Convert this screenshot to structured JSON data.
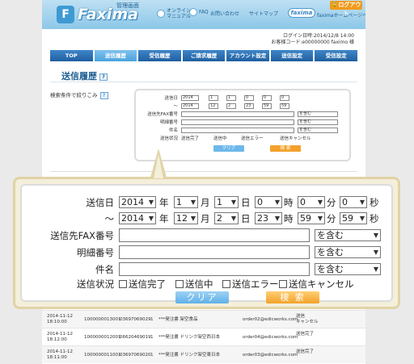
{
  "header": {
    "logo_text": "Faxima",
    "logo_subtitle": "管理画面",
    "nav": [
      {
        "label": "オンライン\nマニュアル"
      },
      {
        "label": "FAQ"
      },
      {
        "label": "お問い合わせ"
      },
      {
        "label": "サイトマップ"
      }
    ],
    "brand_badge": "faxima",
    "home_link": "faximaホームページへ",
    "logout_label": "ログアウト"
  },
  "login_info": {
    "line1": "ログイン日時:2014/12/8 14:00",
    "line2": "お客様コード:e00000000 faximo 様"
  },
  "tabs": [
    {
      "label": "TOP",
      "active": false
    },
    {
      "label": "送信履歴",
      "active": true
    },
    {
      "label": "受信履歴",
      "active": false
    },
    {
      "label": "ご請求履歴",
      "active": false
    },
    {
      "label": "アカウント設定",
      "active": false
    },
    {
      "label": "送信設定",
      "active": false
    },
    {
      "label": "受信設定",
      "active": false
    }
  ],
  "page_title": "送信履歴",
  "filter_label": "検索条件で絞りこみ",
  "search": {
    "date_label": "送信日",
    "range_sep": "〜",
    "from": {
      "year": "2014",
      "month": "1",
      "day": "1",
      "hour": "0",
      "minute": "0",
      "second": "0"
    },
    "to": {
      "year": "2014",
      "month": "12",
      "day": "2",
      "hour": "23",
      "minute": "59",
      "second": "59"
    },
    "units": {
      "year": "年",
      "month": "月",
      "day": "日",
      "hour": "時",
      "minute": "分",
      "second": "秒"
    },
    "fax_label": "送信先FAX番号",
    "detail_label": "明細番号",
    "subject_label": "件名",
    "match_option": "を含む",
    "status_label": "送信状況",
    "status_options": [
      "送信完了",
      "送信中",
      "送信エラー",
      "送信キャンセル"
    ],
    "clear_label": "クリア",
    "search_label": "検 索"
  },
  "table_rows": [
    {
      "date": "2014-11-12",
      "time": "18:10:00",
      "id": "1000000013001",
      "fax": "03697069029",
      "pages": "1",
      "subject": "***発注書 架空食品",
      "email": "order02@edicworks.com",
      "status": "送信\nキャンセル"
    },
    {
      "date": "2014-11-12",
      "time": "18:12:00",
      "id": "1000000012001",
      "fax": "06620469019",
      "pages": "1",
      "subject": "***発注書 ドリンク架空西日本",
      "email": "order04@edicworks.com",
      "status": "送信完了"
    },
    {
      "date": "2014-11-12",
      "time": "18:11:00",
      "id": "1000000011001",
      "fax": "03697069020",
      "pages": "1",
      "subject": "***発注書 ドリンク架空東日本",
      "email": "order03@edicworks.com",
      "status": "送信完了"
    }
  ]
}
